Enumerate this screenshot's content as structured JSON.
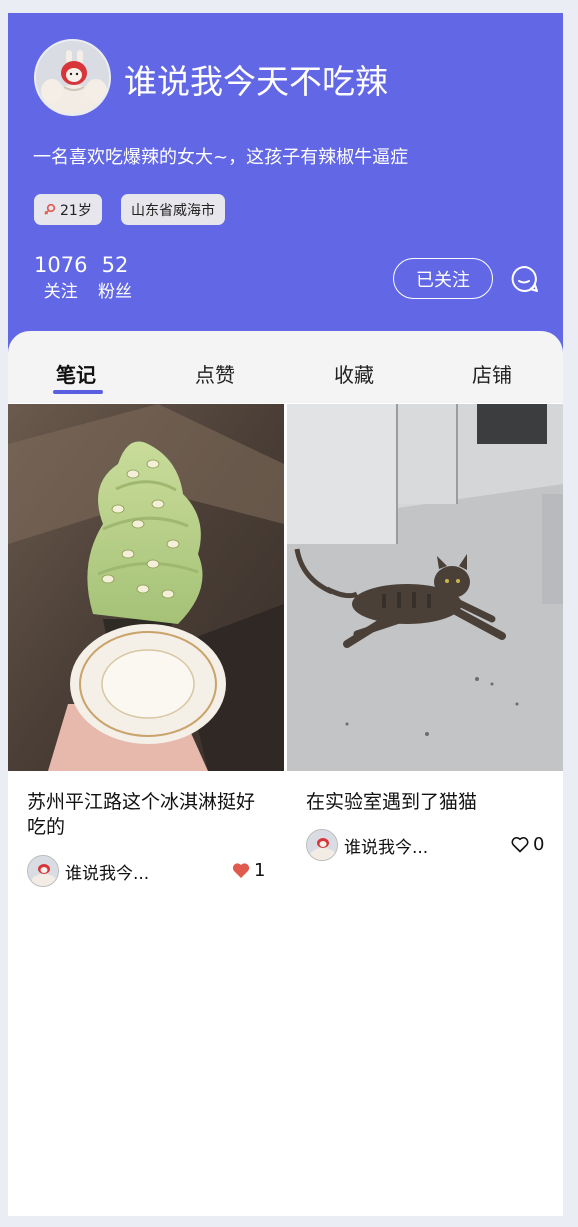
{
  "profile": {
    "nickname": "谁说我今天不吃辣",
    "bio": "一名喜欢吃爆辣的女大~，这孩子有辣椒牛逼症",
    "tags": {
      "age": "21岁",
      "location": "山东省威海市"
    },
    "stats": {
      "following_count": "1076",
      "following_label": "关注",
      "fans_count": "52",
      "fans_label": "粉丝"
    },
    "follow_button": "已关注",
    "avatar_icon": "muscle-bunny-avatar",
    "chat_icon": "chat-bubble-icon"
  },
  "colors": {
    "header_bg": "#6267e6",
    "tab_underline": "#5a5fe0",
    "like_active": "#e15a4e"
  },
  "tabs": [
    {
      "label": "笔记",
      "active": true
    },
    {
      "label": "点赞",
      "active": false
    },
    {
      "label": "收藏",
      "active": false
    },
    {
      "label": "店铺",
      "active": false
    }
  ],
  "notes": [
    {
      "title": "苏州平江路这个冰淇淋挺好吃的",
      "author": "谁说我今...",
      "likes": "1",
      "liked": true,
      "image": "matcha-ice-cream-cone-photo"
    },
    {
      "title": "在实验室遇到了猫猫",
      "author": "谁说我今...",
      "likes": "0",
      "liked": false,
      "image": "tabby-cat-on-floor-photo"
    }
  ]
}
